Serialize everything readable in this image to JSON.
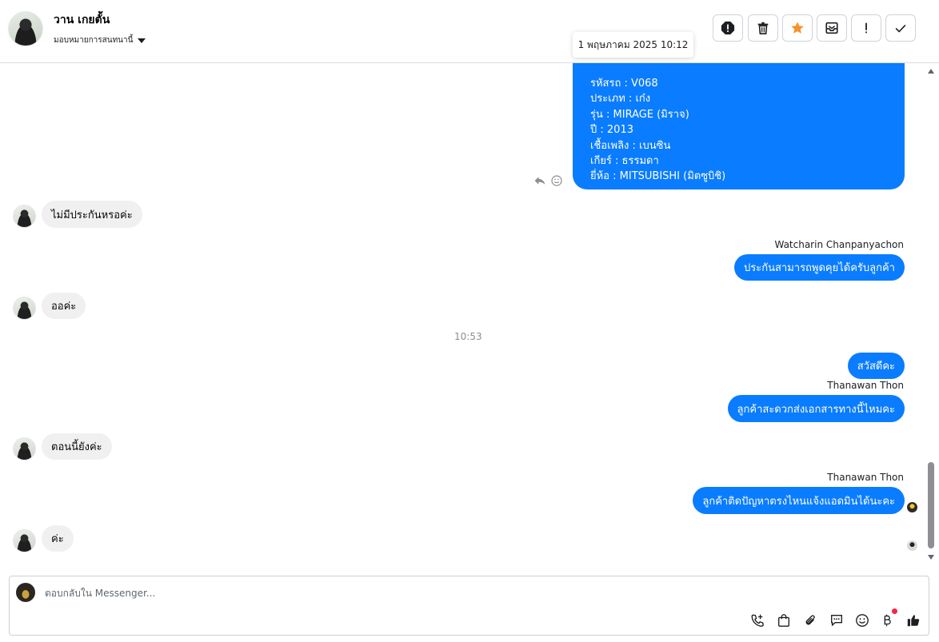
{
  "header": {
    "contact_name": "วาน เกยตั้น",
    "assign_label": "มอบหมายการสนทนานี้",
    "toolbar": [
      "spam-icon",
      "trash-icon",
      "star-icon",
      "archive-icon",
      "exclamation-icon",
      "check-icon"
    ]
  },
  "tooltip": {
    "datetime": "1 พฤษภาคม 2025 10:12"
  },
  "chat": {
    "car_details": [
      "รหัสรถ : V068",
      "ประเภท : เก๋ง",
      "รุ่น : MIRAGE (มิราจ)",
      "ปี : 2013",
      "เชื้อเพลิง : เบนซิน",
      "เกียร์ : ธรรมดา",
      "ยี่ห้อ : MITSUBISHI (มิตซูบิชิ)"
    ],
    "msg_in_1": "ไม่มีประกันหรอค่ะ",
    "sender_1": "Watcharin Chanpanyachon",
    "msg_out_1": "ประกันสามารถพูดคุยได้ครับลูกค้า",
    "msg_in_2": "ออค่ะ",
    "timestamp": "10:53",
    "msg_out_2": "สวัสดีคะ",
    "sender_2": "Thanawan Thon",
    "msg_out_3": "ลูกค้าสะดวกส่งเอกสารทางนี้ไหมคะ",
    "msg_in_3": "ตอนนี้ยังค่ะ",
    "sender_3": "Thanawan Thon",
    "msg_out_4": "ลูกค้าติดปัญหาตรงไหนแจ้งแอดมินได้นะคะ",
    "msg_in_4": "ค่ะ"
  },
  "composer": {
    "placeholder": "ตอบกลับใน Messenger...",
    "value": "",
    "tools": [
      "call-add-icon",
      "shopping-bag-icon",
      "attach-icon",
      "saved-reply-icon",
      "emoji-icon",
      "baht-icon",
      "like-icon"
    ]
  },
  "colors": {
    "accent": "#0a7cff",
    "star": "#f5922a",
    "notify_dot": "#f02849"
  }
}
